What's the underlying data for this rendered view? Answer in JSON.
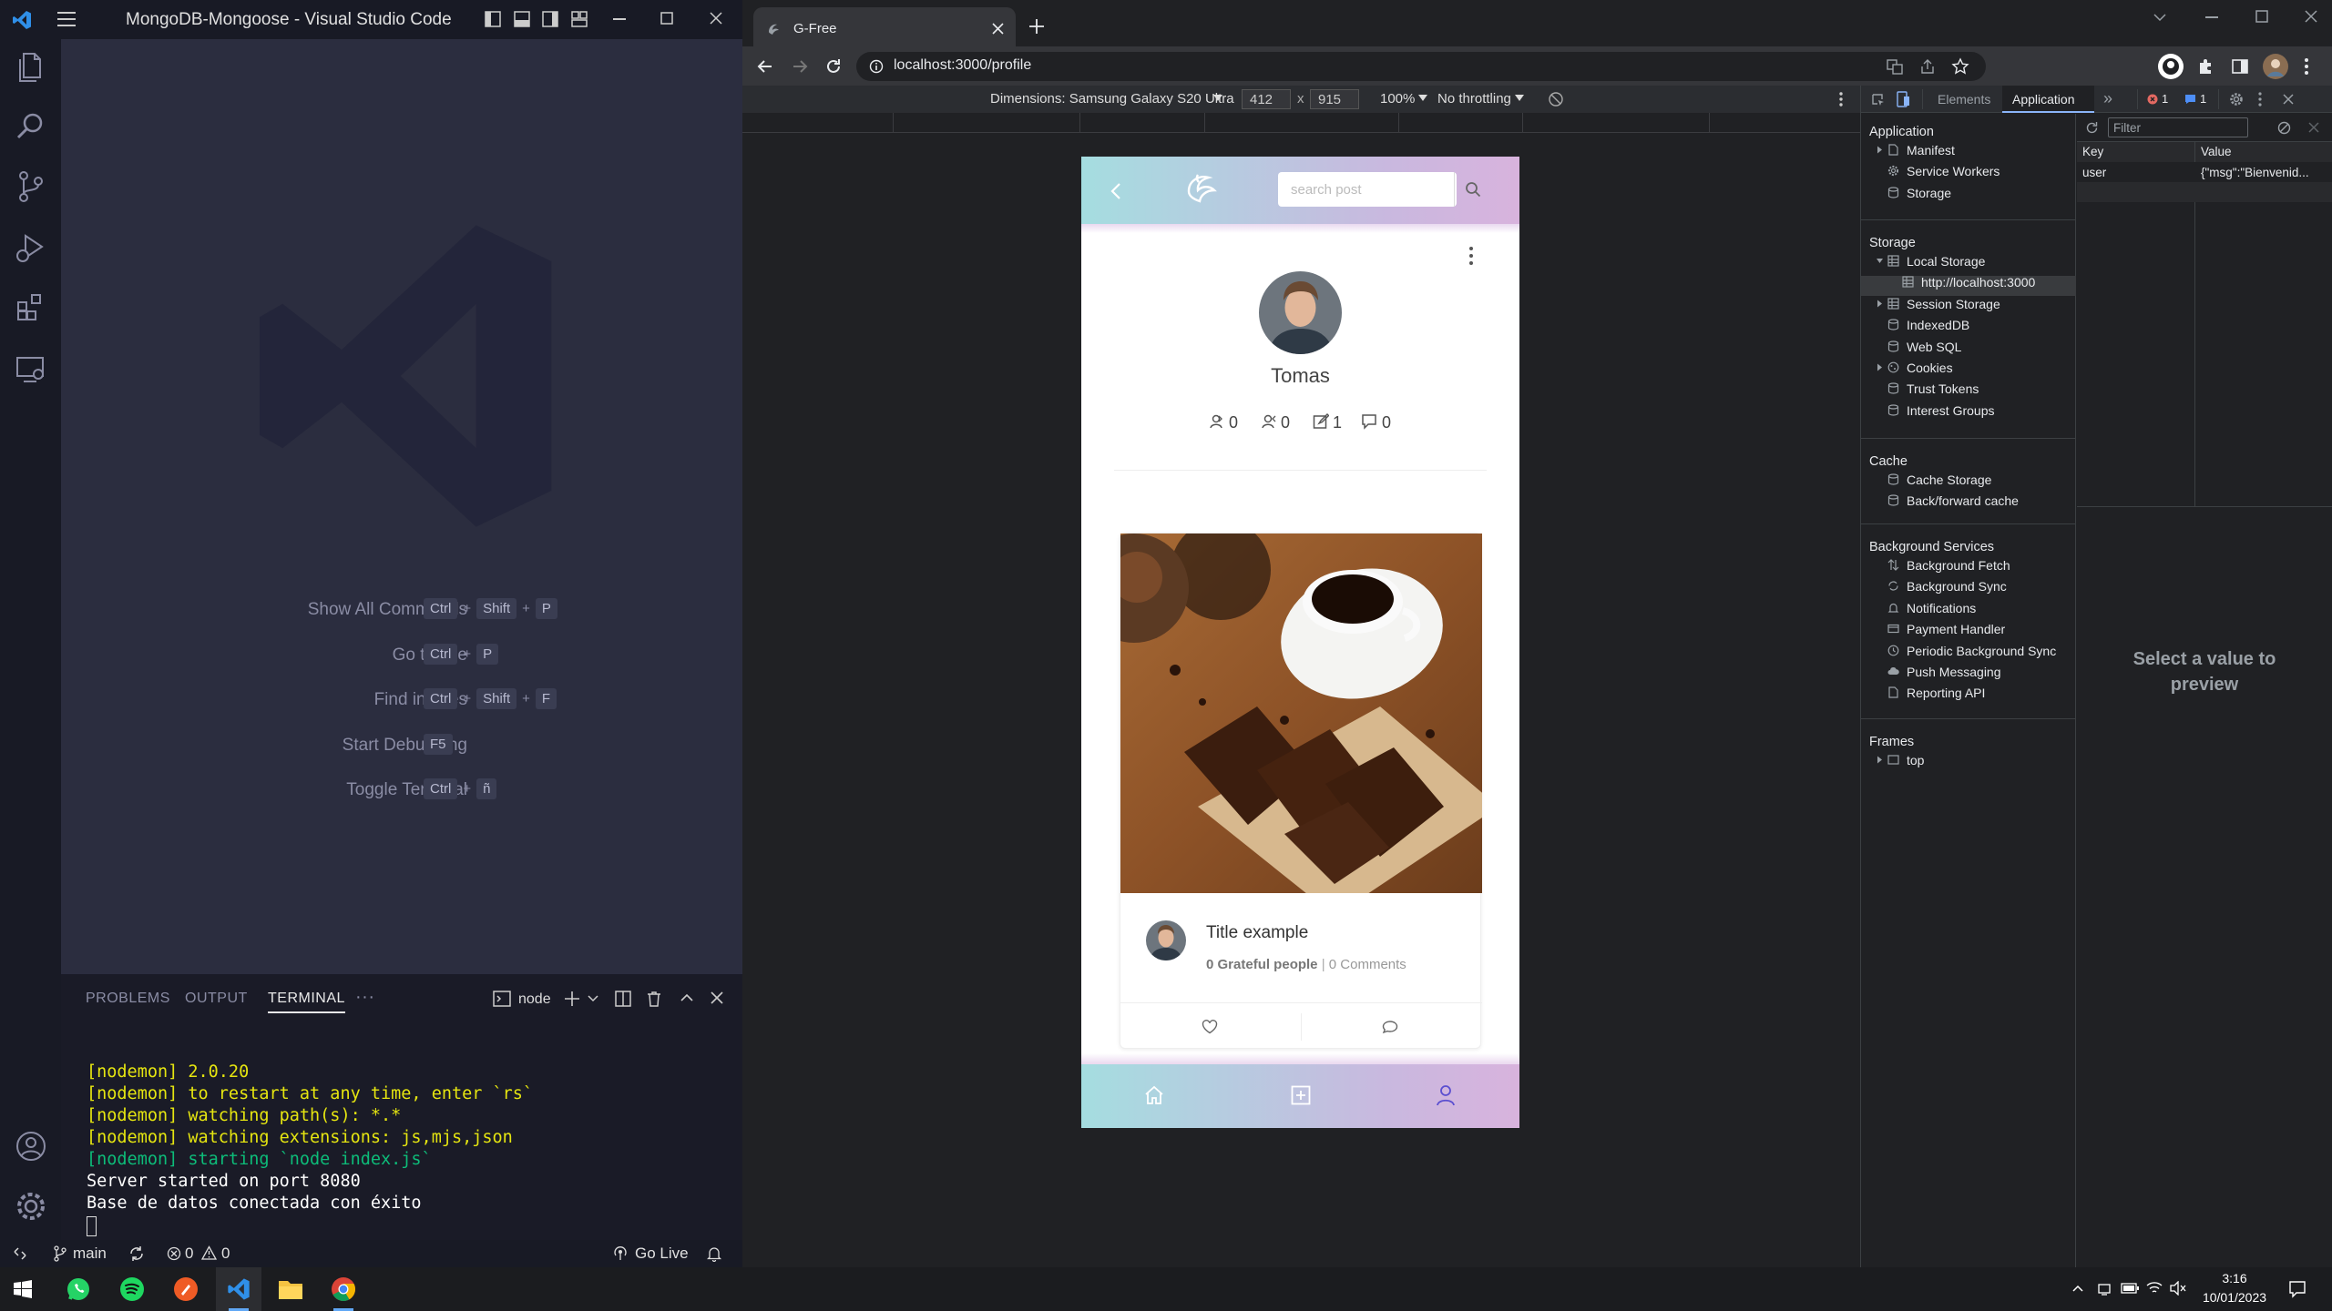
{
  "vscode": {
    "title": "MongoDB-Mongoose - Visual Studio Code",
    "commands": [
      {
        "name": "Show All Commands",
        "keys": [
          "Ctrl",
          "Shift",
          "P"
        ]
      },
      {
        "name": "Go to File",
        "keys": [
          "Ctrl",
          "P"
        ]
      },
      {
        "name": "Find in Files",
        "keys": [
          "Ctrl",
          "Shift",
          "F"
        ]
      },
      {
        "name": "Start Debugging",
        "keys": [
          "F5"
        ]
      },
      {
        "name": "Toggle Terminal",
        "keys": [
          "Ctrl",
          "ñ"
        ]
      }
    ],
    "panel_tabs": [
      "PROBLEMS",
      "OUTPUT",
      "TERMINAL"
    ],
    "panel_more": "···",
    "terminal_name": "node",
    "terminal_lines": [
      {
        "text": "[nodemon] 2.0.20",
        "color": "#e5e510"
      },
      {
        "text": "[nodemon] to restart at any time, enter `rs`",
        "color": "#e5e510"
      },
      {
        "text": "[nodemon] watching path(s): *.*",
        "color": "#e5e510"
      },
      {
        "text": "[nodemon] watching extensions: js,mjs,json",
        "color": "#e5e510"
      },
      {
        "text": "[nodemon] starting `node index.js`",
        "color": "#0dbc79"
      },
      {
        "text": "Server started on port 8080",
        "color": "#ffffff"
      },
      {
        "text": "Base de datos conectada con éxito",
        "color": "#ffffff"
      }
    ],
    "status": {
      "branch": "main",
      "errors": "0",
      "warnings": "0",
      "golive": "Go Live"
    }
  },
  "chrome": {
    "tab_title": "G-Free",
    "url": "localhost:3000/profile",
    "device_label": "Dimensions: Samsung Galaxy S20 Ultra",
    "width": "412",
    "height": "915",
    "times": "x",
    "zoom": "100%",
    "throttle": "No throttling"
  },
  "app": {
    "search_placeholder": "search post",
    "username": "Tomas",
    "stats": [
      "0",
      "0",
      "1",
      "0"
    ],
    "post_title": "Title example",
    "grateful": "0 Grateful people",
    "separator": "|",
    "comments": "0 Comments"
  },
  "devtools": {
    "tabs": [
      "Elements",
      "Application"
    ],
    "more": "»",
    "error_count": "1",
    "msg_count": "1",
    "sections": {
      "application": "Application",
      "storage": "Storage",
      "cache": "Cache",
      "background": "Background Services",
      "frames": "Frames"
    },
    "application_items": [
      "Manifest",
      "Service Workers",
      "Storage"
    ],
    "storage_items": [
      "Local Storage",
      "http://localhost:3000",
      "Session Storage",
      "IndexedDB",
      "Web SQL",
      "Cookies",
      "Trust Tokens",
      "Interest Groups"
    ],
    "cache_items": [
      "Cache Storage",
      "Back/forward cache"
    ],
    "background_items": [
      "Background Fetch",
      "Background Sync",
      "Notifications",
      "Payment Handler",
      "Periodic Background Sync",
      "Push Messaging",
      "Reporting API"
    ],
    "frames_items": [
      "top"
    ],
    "filter_placeholder": "Filter",
    "key_header": "Key",
    "value_header": "Value",
    "row_key": "user",
    "row_value": "{\"msg\":\"Bienvenid...",
    "preview": "Select a value to preview"
  },
  "taskbar": {
    "time": "3:16",
    "date": "10/01/2023"
  }
}
